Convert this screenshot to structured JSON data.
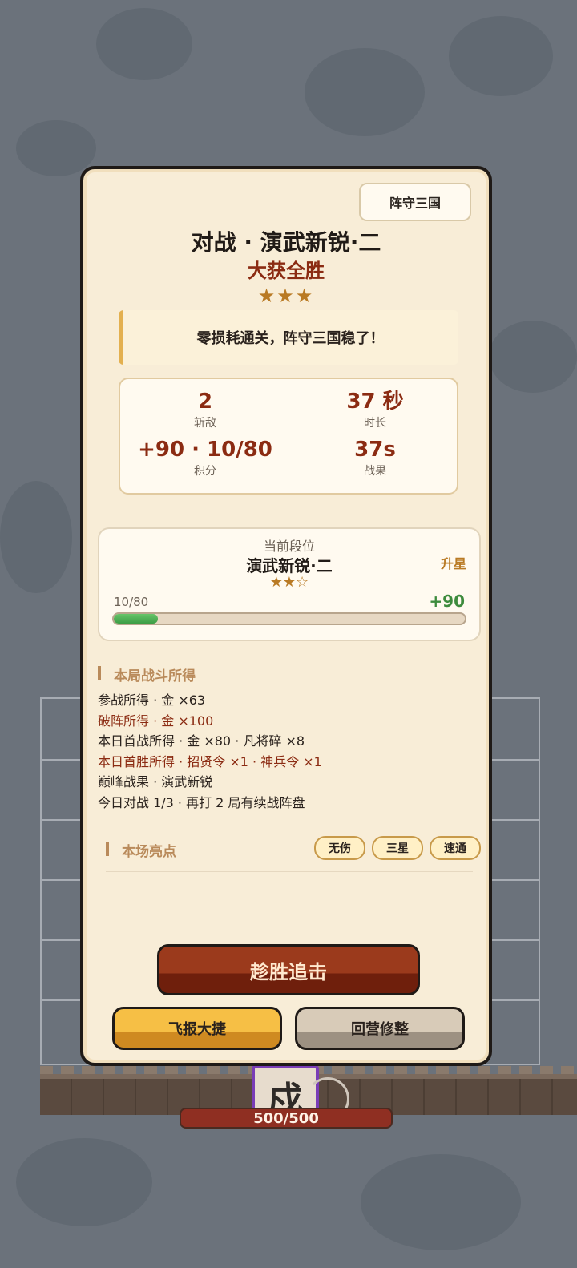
{
  "mode_tag": "阵守三国",
  "title": "对战 · 演武新锐·二",
  "result": "大获全胜",
  "stars": "★★★",
  "banner": "零损耗通关，阵守三国稳了！",
  "stats": {
    "kills": {
      "value": "2",
      "label": "斩敌"
    },
    "duration": {
      "value": "37 秒",
      "label": "时长"
    },
    "points": {
      "value": "+90 · 10/80",
      "label": "积分"
    },
    "record": {
      "value": "37s",
      "label": "战果"
    }
  },
  "rank": {
    "caption": "当前段位",
    "name": "演武新锐·二",
    "stars": "★★☆",
    "upgrade": "升星",
    "progress_text": "10/80",
    "progress_fraction": 0.125,
    "gain": "+90"
  },
  "rewards_section": {
    "title": "本局战斗所得",
    "lines": [
      {
        "text": "参战所得 · 金 ×63",
        "highlight": false
      },
      {
        "text": "破阵所得 · 金 ×100",
        "highlight": true
      },
      {
        "text": "本日首战所得 · 金 ×80 · 凡将碎 ×8",
        "highlight": false
      },
      {
        "text": "本日首胜所得 · 招贤令 ×1 · 神兵令 ×1",
        "highlight": true
      },
      {
        "text": "巅峰战果 · 演武新锐",
        "highlight": false
      },
      {
        "text": "今日对战 1/3 · 再打 2 局有续战阵盘",
        "highlight": false
      }
    ]
  },
  "highlights_section": {
    "title": "本场亮点",
    "chips": [
      "无伤",
      "三星",
      "速通"
    ]
  },
  "buttons": {
    "pursue": "趁胜追击",
    "share": "飞报大捷",
    "return": "回营修整"
  },
  "unit": {
    "char": "戍",
    "hp": "500/500"
  }
}
